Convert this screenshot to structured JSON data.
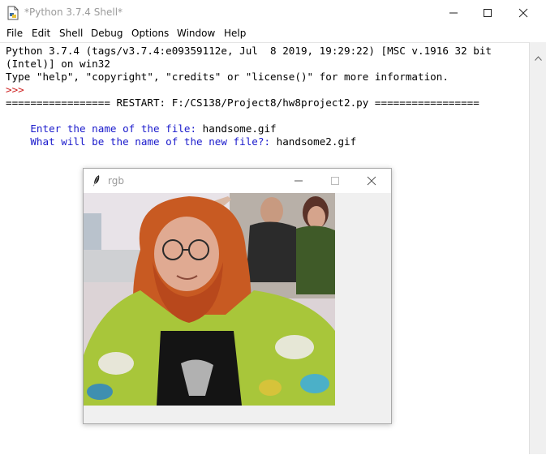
{
  "window": {
    "title": "*Python 3.7.4 Shell*"
  },
  "menu": [
    "File",
    "Edit",
    "Shell",
    "Debug",
    "Options",
    "Window",
    "Help"
  ],
  "shell": {
    "lines": [
      {
        "text": "Python 3.7.4 (tags/v3.7.4:e09359112e, Jul  8 2019, 19:29:22) [MSC v.1916 32 bit",
        "color": "#000000"
      },
      {
        "text": "(Intel)] on win32",
        "color": "#000000"
      },
      {
        "text": "Type \"help\", \"copyright\", \"credits\" or \"license()\" for more information.",
        "color": "#000000"
      },
      {
        "text": ">>> ",
        "color": "#cc1a1a"
      },
      {
        "text": "================= RESTART: F:/CS138/Project8/hw8project2.py =================",
        "color": "#000000"
      }
    ],
    "prompt1": {
      "question": "Enter the name of the file: ",
      "answer": "handsome.gif"
    },
    "prompt2": {
      "question": "What will be the name of the new file?: ",
      "answer": "handsome2.gif"
    }
  },
  "rgb_window": {
    "title": "rgb"
  },
  "icons": {
    "app": "python-shell-icon",
    "feather": "tk-feather-icon",
    "minimize": "minimize-icon",
    "maximize": "maximize-icon",
    "close": "close-icon"
  },
  "colors": {
    "output": "#000000",
    "input_prompt": "#1a1acc",
    "shell_prompt": "#cc1a1a"
  }
}
